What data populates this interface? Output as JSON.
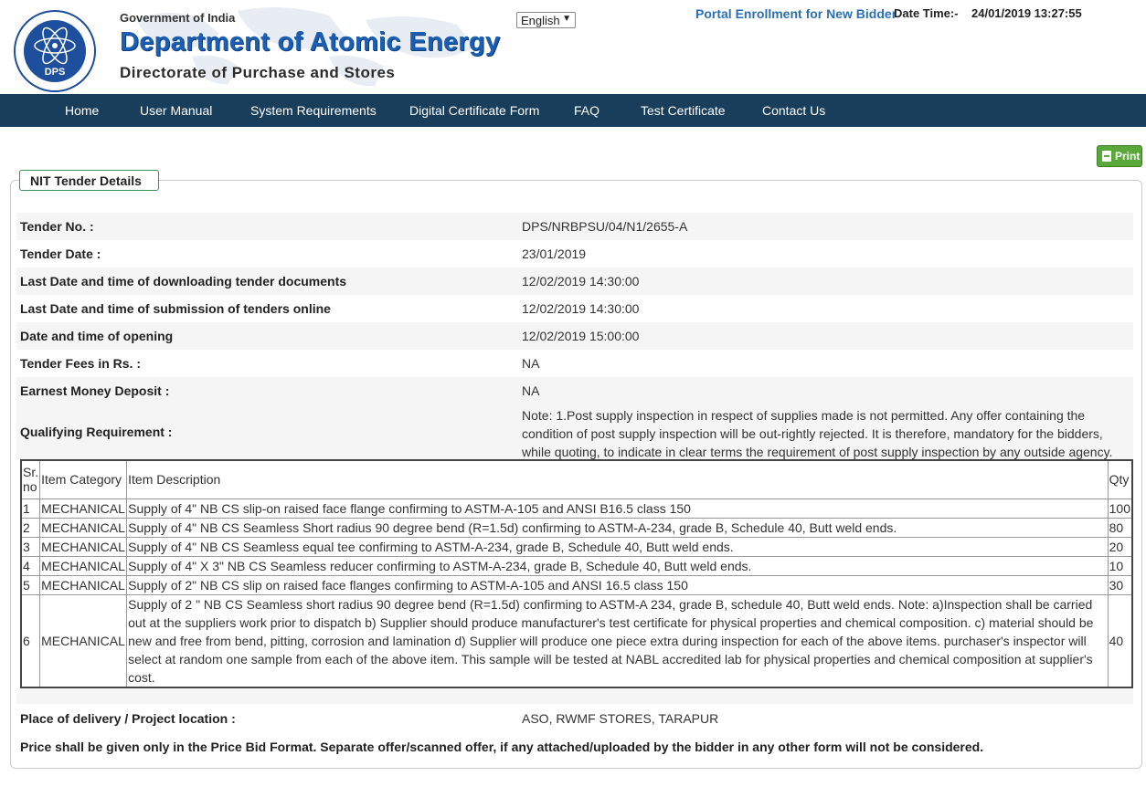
{
  "header": {
    "gov_text": "Government of India",
    "dept_text": "Department of Atomic Energy",
    "dir_text": "Directorate of Purchase and Stores",
    "logo_text": "DPS",
    "language": "English",
    "enroll_link": "Portal Enrollment for New Bidder",
    "datetime_label": "Date Time:-",
    "datetime_value": "24/01/2019 13:27:55"
  },
  "nav": [
    "Home",
    "User Manual",
    "System Requirements",
    "Digital Certificate Form",
    "FAQ",
    "Test Certificate",
    "Contact Us"
  ],
  "print_label": "Print",
  "section_title": "NIT Tender Details",
  "details": [
    {
      "label": "Tender No. :",
      "value": "DPS/NRBPSU/04/N1/2655-A"
    },
    {
      "label": "Tender Date :",
      "value": "23/01/2019"
    },
    {
      "label": "Last Date and time of downloading tender documents",
      "value": "12/02/2019 14:30:00"
    },
    {
      "label": "Last Date and time of submission of tenders online",
      "value": "12/02/2019 14:30:00"
    },
    {
      "label": "Date and time of opening",
      "value": "12/02/2019 15:00:00"
    },
    {
      "label": "Tender Fees in Rs. :",
      "value": "NA"
    },
    {
      "label": "Earnest Money Deposit :",
      "value": "NA"
    }
  ],
  "qualifying": {
    "label": "Qualifying Requirement :",
    "value": "Note: 1.Post supply inspection in respect of supplies made is not permitted. Any offer containing the condition of post supply inspection will be out-rightly rejected. It is therefore, mandatory for the bidders, while quoting, to indicate in clear terms the requirement of post supply inspection by any outside agency."
  },
  "items": {
    "headers": [
      "Sr. no",
      "Item Category",
      "Item Description",
      "Qty"
    ],
    "rows": [
      [
        "1",
        "MECHANICAL",
        "Supply of 4\" NB CS slip-on raised face flange confirming to ASTM-A-105 and ANSI B16.5 class 150",
        "100"
      ],
      [
        "2",
        "MECHANICAL",
        "Supply of 4\" NB CS Seamless Short radius 90 degree bend (R=1.5d) confirming to ASTM-A-234, grade B, Schedule 40, Butt weld ends.",
        "80"
      ],
      [
        "3",
        "MECHANICAL",
        "Supply of 4\" NB CS Seamless equal tee confirming to ASTM-A-234, grade B, Schedule 40, Butt weld ends.",
        "20"
      ],
      [
        "4",
        "MECHANICAL",
        "Supply of 4\" X 3\" NB CS Seamless reducer confirming to ASTM-A-234, grade B, Schedule 40, Butt weld ends.",
        "10"
      ],
      [
        "5",
        "MECHANICAL",
        "Supply of 2\" NB CS slip on raised face flanges confirming to ASTM-A-105 and ANSI 16.5 class 150",
        "30"
      ],
      [
        "6",
        "MECHANICAL",
        "Supply of 2 \" NB CS Seamless short radius 90 degree bend (R=1.5d) confirming to ASTM-A 234, grade B, schedule 40, Butt weld ends. Note: a)Inspection shall be carried out at the suppliers work prior to dispatch b) Supplier should produce manufacturer's test certificate for physical properties and chemical composition. c) material should be new and free from bend, pitting, corrosion and lamination d) Supplier will produce one piece extra during inspection for each of the above items. purchaser's inspector will select at random one sample from each of the above item. This sample will be tested at NABL accredited lab for physical properties and chemical composition at supplier's cost.",
        "40"
      ]
    ]
  },
  "delivery": {
    "label": "Place of delivery / Project location :",
    "value": "ASO, RWMF STORES, TARAPUR"
  },
  "price_note": "Price shall be given only in the Price Bid Format. Separate offer/scanned offer, if any attached/uploaded by the bidder in any other form will not be considered.",
  "colors": {
    "nav_bg": "#183e5c",
    "brand_blue": "#1a5fb4",
    "link": "#2a6fb5",
    "print_green": "#5aa83a",
    "legend_border": "#3c8f57"
  }
}
